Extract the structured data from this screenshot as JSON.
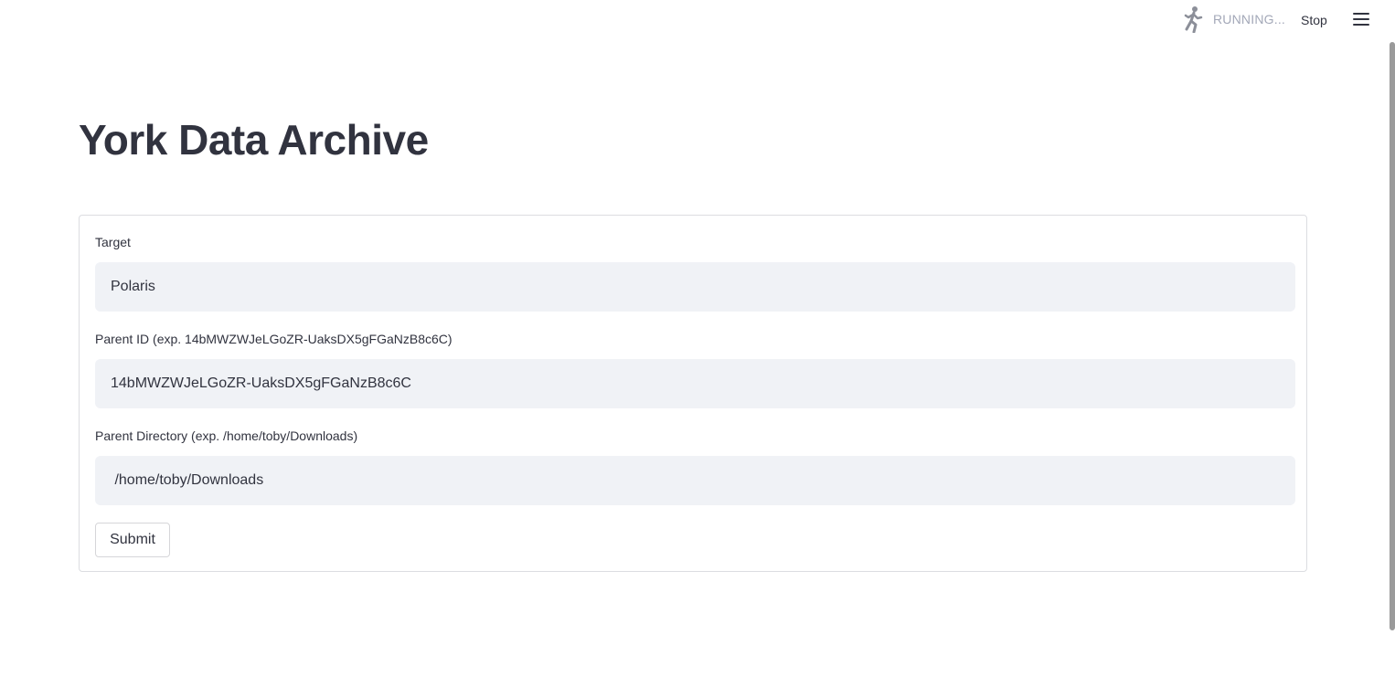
{
  "header": {
    "status_text": "RUNNING...",
    "stop_label": "Stop",
    "status_icon": "running-man-icon",
    "menu_icon": "hamburger-menu-icon"
  },
  "page": {
    "title": "York Data Archive"
  },
  "form": {
    "target": {
      "label": "Target",
      "value": "Polaris"
    },
    "parent_id": {
      "label": "Parent ID (exp. 14bMWZWJeLGoZR-UaksDX5gFGaNzB8c6C)",
      "value": "14bMWZWJeLGoZR-UaksDX5gFGaNzB8c6C"
    },
    "parent_directory": {
      "label": "Parent Directory (exp. /home/toby/Downloads)",
      "value": " /home/toby/Downloads"
    },
    "submit_label": "Submit"
  },
  "colors": {
    "text": "#31333f",
    "input_bg": "#f0f2f6",
    "muted": "#a3a8b8",
    "border": "#dcdde1"
  }
}
